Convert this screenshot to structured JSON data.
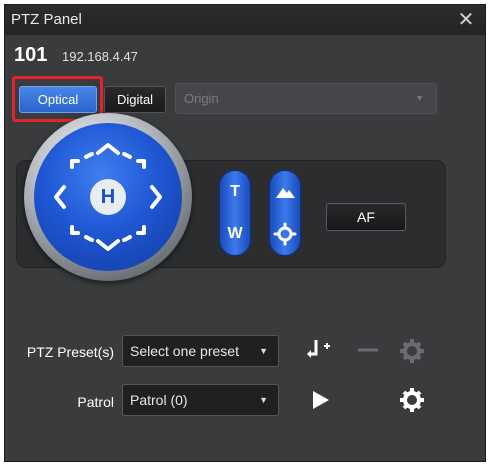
{
  "window": {
    "title": "PTZ Panel",
    "close_glyph": "✕"
  },
  "camera": {
    "id": "101",
    "ip": "192.168.4.47"
  },
  "mode_tabs": {
    "optical_label": "Optical",
    "digital_label": "Digital",
    "active": "Optical"
  },
  "position_select": {
    "value": "Origin",
    "enabled": false
  },
  "joystick": {
    "center_label": "H"
  },
  "zoom": {
    "top_label": "T",
    "bottom_label": "W"
  },
  "focus": {
    "top_icon": "mountain-icon",
    "bottom_icon": "gear-icon"
  },
  "af_button": {
    "label": "AF"
  },
  "preset": {
    "label": "PTZ Preset(s)",
    "value": "Select one preset",
    "icons": [
      "add-preset-icon",
      "remove-preset-icon",
      "preset-settings-icon"
    ]
  },
  "patrol": {
    "label": "Patrol",
    "value": "Patrol (0)",
    "icons": [
      "play-icon",
      "patrol-settings-icon"
    ]
  },
  "colors": {
    "panel": "#3a3b3d",
    "accent_blue": "#2a63cc",
    "highlight_red": "#e2242f"
  }
}
